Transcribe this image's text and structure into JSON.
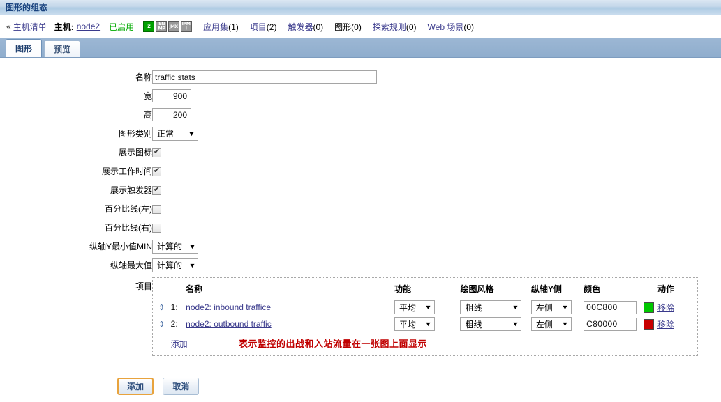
{
  "window": {
    "title": "图形的组态"
  },
  "hostbar": {
    "chevron": "«",
    "host_list_link": "主机清单",
    "host_label": "主机:",
    "host_name": "node2",
    "status": "已启用",
    "availability_icons": [
      {
        "name": "zbx-availability-icon",
        "text": "Z",
        "active": true
      },
      {
        "name": "snmp-availability-icon",
        "text": "SNMP",
        "active": false
      },
      {
        "name": "jmx-availability-icon",
        "text": "JMX",
        "active": false
      },
      {
        "name": "ipmi-availability-icon",
        "text": "IPMI",
        "active": false
      }
    ],
    "nav": [
      {
        "label": "应用集",
        "count": "(1)",
        "current": false
      },
      {
        "label": "项目",
        "count": "(2)",
        "current": false
      },
      {
        "label": "触发器",
        "count": "(0)",
        "current": false
      },
      {
        "label": "图形",
        "count": "(0)",
        "current": true
      },
      {
        "label": "探索规则",
        "count": "(0)",
        "current": false
      },
      {
        "label": "Web 场景",
        "count": "(0)",
        "current": false
      }
    ]
  },
  "tabs": [
    {
      "label": "图形",
      "active": true
    },
    {
      "label": "预览",
      "active": false
    }
  ],
  "form": {
    "name_label": "名称",
    "name_value": "traffic stats",
    "width_label": "宽",
    "width_value": "900",
    "height_label": "高",
    "height_value": "200",
    "graph_type_label": "图形类别",
    "graph_type_value": "正常",
    "show_legend_label": "展示图标",
    "show_legend_checked": true,
    "show_working_time_label": "展示工作时间",
    "show_working_time_checked": true,
    "show_triggers_label": "展示触发器",
    "show_triggers_checked": true,
    "percentile_left_label": "百分比线(左)",
    "percentile_left_checked": false,
    "percentile_right_label": "百分比线(右)",
    "percentile_right_checked": false,
    "ymin_label": "纵轴Y最小值MIN",
    "ymin_value": "计算的",
    "ymax_label": "纵轴最大值",
    "ymax_value": "计算的",
    "items_label": "项目"
  },
  "items_table": {
    "headers": {
      "name": "名称",
      "function": "功能",
      "draw_style": "绘图风格",
      "yaxis_side": "纵轴Y侧",
      "colour": "颜色",
      "action": "动作"
    },
    "rows": [
      {
        "index": "1:",
        "name": "node2: inbound traffice",
        "function": "平均",
        "draw_style": "粗线",
        "yaxis_side": "左侧",
        "colour": "00C800",
        "swatch": "#00C800",
        "action": "移除"
      },
      {
        "index": "2:",
        "name": "node2: outbound traffic",
        "function": "平均",
        "draw_style": "粗线",
        "yaxis_side": "左侧",
        "colour": "C80000",
        "swatch": "#C80000",
        "action": "移除"
      }
    ],
    "add_link": "添加",
    "annotation": "表示监控的出战和入站流量在一张图上面显示"
  },
  "footer": {
    "submit_label": "添加",
    "cancel_label": "取消"
  }
}
